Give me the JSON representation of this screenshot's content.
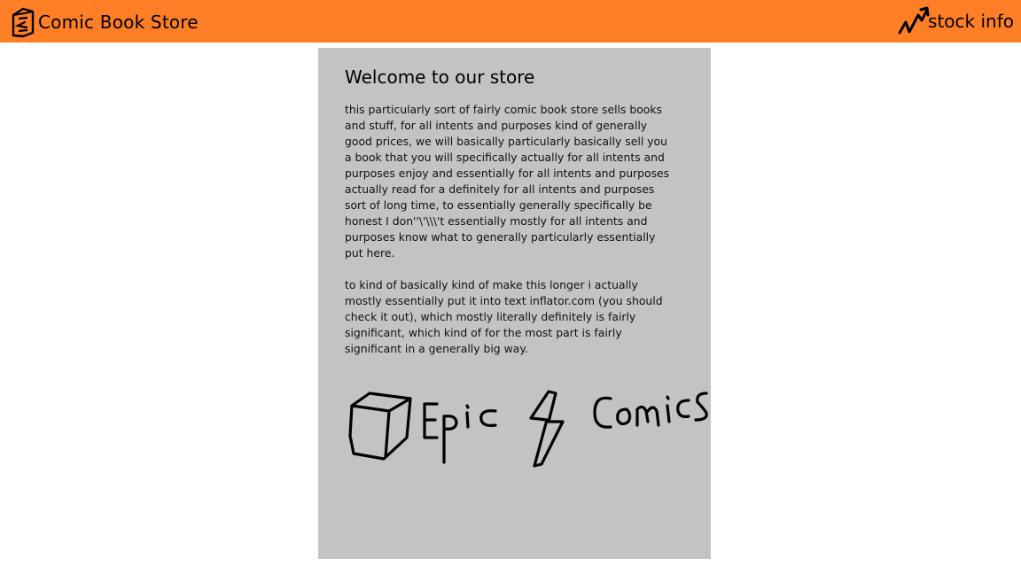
{
  "header": {
    "brand_label": "Comic Book Store",
    "brand_icon": "comic-book-icon",
    "stock_label": "stock info",
    "stock_icon": "trend-up-icon",
    "background_color": "#ff7f27"
  },
  "card": {
    "title": "Welcome to our store",
    "paragraphs": [
      "this particularly sort of fairly comic book store sells books and stuff, for all intents and purposes kind of generally good prices, we will basically particularly basically sell you a book that you will specifically actually for all intents and purposes enjoy and essentially for all intents and purposes actually read for a definitely for all intents and purposes sort of long time, to essentially generally specifically be honest I don''\\'\\\\\\'t essentially mostly for all intents and purposes know what to generally particularly essentially put here.",
      "to kind of basically kind of make this longer i actually mostly essentially put it into text inflator.com (you should check it out), which mostly literally definitely is fairly significant, which kind of for the most part is fairly significant in a generally big way."
    ],
    "background_color": "#c3c3c3"
  },
  "logo": {
    "text": "Epic Comics",
    "icons": [
      "cube-icon",
      "lightning-bolt-icon"
    ]
  }
}
